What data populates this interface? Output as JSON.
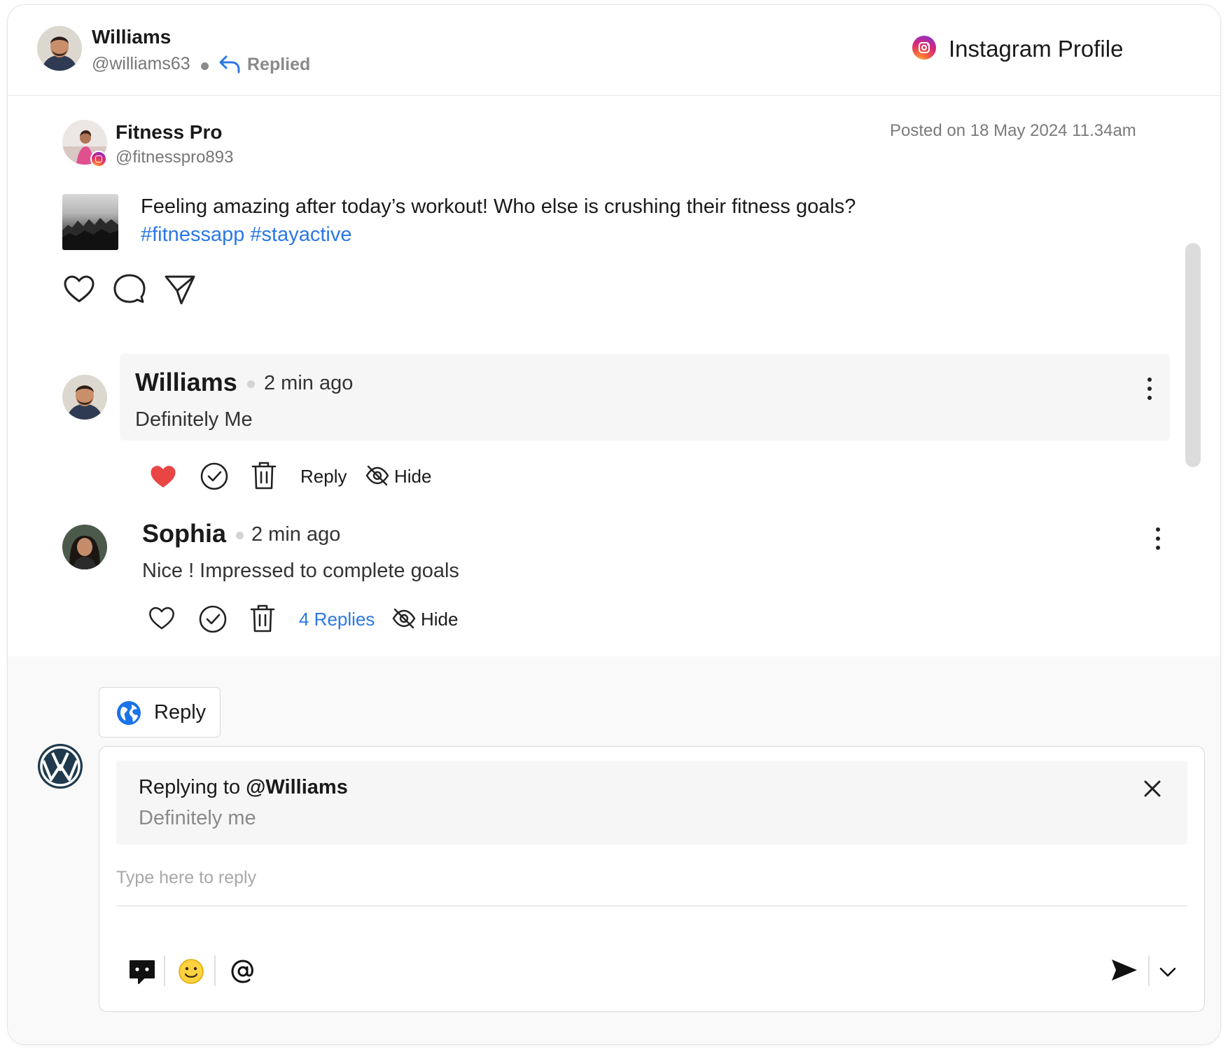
{
  "header": {
    "user_name": "Williams",
    "user_handle": "@williams63",
    "status_label": "Replied",
    "platform_label": "Instagram Profile"
  },
  "post": {
    "author_name": "Fitness Pro",
    "author_handle": "@fitnesspro893",
    "posted_on": "Posted on 18 May 2024 11.34am",
    "text": "Feeling amazing after today’s workout! Who else is crushing their fitness goals?",
    "hashtags": "#fitnessapp #stayactive"
  },
  "comments": [
    {
      "name": "Williams",
      "time": "2 min ago",
      "text": "Definitely Me",
      "liked": true,
      "reply_label": "Reply",
      "hide_label": "Hide"
    },
    {
      "name": "Sophia",
      "time": "2 min ago",
      "text": "Nice ! Impressed to complete goals",
      "liked": false,
      "replies_label": "4 Replies",
      "hide_label": "Hide"
    }
  ],
  "composer": {
    "mode_label": "Reply",
    "replying_prefix": "Replying to",
    "replying_to": "@Williams",
    "quoted_text": "Definitely me",
    "placeholder": "Type here to reply"
  },
  "colors": {
    "accent_blue": "#2b78e4",
    "like_red": "#e94545",
    "brand_navy": "#1f3a4d"
  }
}
